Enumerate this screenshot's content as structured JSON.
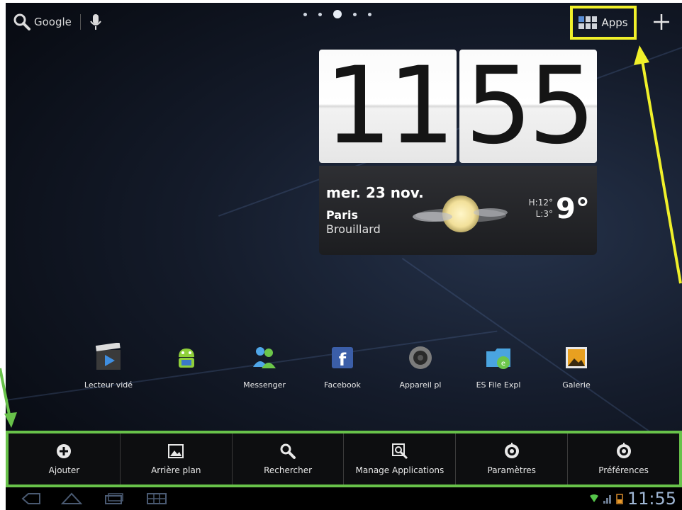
{
  "top_bar": {
    "search_label": "Google",
    "apps_label": "Apps"
  },
  "clock": {
    "hours": "11",
    "minutes": "55",
    "date": "mer. 23 nov.",
    "city": "Paris",
    "condition": "Brouillard",
    "high": "H:12°",
    "low": "L:3°",
    "temperature": "9°"
  },
  "apps": [
    {
      "label": "Lecteur vidé",
      "icon": "video-player-icon"
    },
    {
      "label": "",
      "icon": "android-icon"
    },
    {
      "label": "Messenger",
      "icon": "messenger-icon"
    },
    {
      "label": "Facebook",
      "icon": "facebook-icon"
    },
    {
      "label": "Appareil pl",
      "icon": "camera-icon"
    },
    {
      "label": "ES File Expl",
      "icon": "es-file-explorer-icon"
    },
    {
      "label": "Galerie",
      "icon": "gallery-icon"
    }
  ],
  "menu": [
    {
      "label": "Ajouter",
      "icon": "plus-circle-icon"
    },
    {
      "label": "Arrière plan",
      "icon": "wallpaper-icon"
    },
    {
      "label": "Rechercher",
      "icon": "search-icon"
    },
    {
      "label": "Manage Applications",
      "icon": "manage-apps-icon"
    },
    {
      "label": "Paramètres",
      "icon": "settings-icon"
    },
    {
      "label": "Préférences",
      "icon": "preferences-icon"
    }
  ],
  "status": {
    "time": "11:55"
  },
  "colors": {
    "highlight_yellow": "#f0f02a",
    "highlight_green": "#68c24a"
  }
}
